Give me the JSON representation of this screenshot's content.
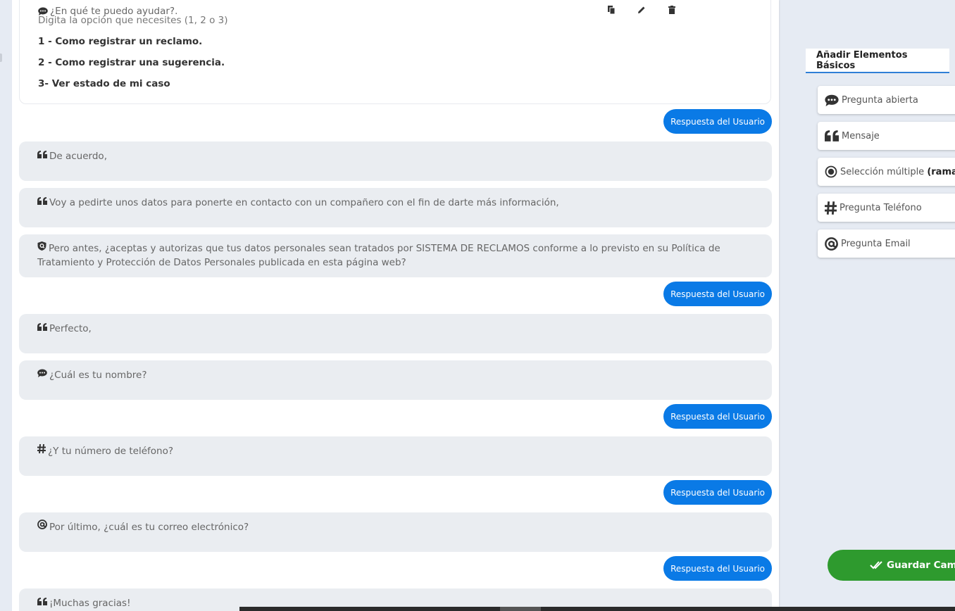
{
  "top_card": {
    "question": "¿En qué te puedo ayudar?.",
    "subtitle": "Digita la opción que necesites (1, 2 o 3)",
    "options": [
      "1 - Como registrar un reclamo.",
      "2 - Como registrar una sugerencia.",
      "3-  Ver estado de mi caso"
    ],
    "actions": [
      "copy-icon",
      "pencil-icon",
      "trash-icon"
    ]
  },
  "reply_label": "Respuesta del Usuario",
  "messages": [
    {
      "icon": "quote-icon",
      "text": "De acuerdo,"
    },
    {
      "icon": "quote-icon",
      "text": "Voy a pedirte unos datos para ponerte en contacto con un compañero con el fin de darte más información,"
    },
    {
      "icon": "shield-icon",
      "text": "Pero antes, ¿aceptas y autorizas que tus datos personales sean tratados por SISTEMA DE RECLAMOS conforme a lo previsto en su Política de Tratamiento y Protección de Datos Personales publicada en esta página web?"
    },
    {
      "icon": "quote-icon",
      "text": "Perfecto,"
    },
    {
      "icon": "comment-icon",
      "text": "¿Cuál es tu nombre?"
    },
    {
      "icon": "hash-icon",
      "text": "¿Y tu número de teléfono?"
    },
    {
      "icon": "at-icon",
      "text": "Por último, ¿cuál es tu correo electrónico?"
    },
    {
      "icon": "quote-icon",
      "text": "¡Muchas gracias!"
    }
  ],
  "sidebar": {
    "tab_title": "Añadir Elementos Básicos",
    "elements": [
      {
        "icon": "comment-icon",
        "label": "Pregunta abierta",
        "bold": ""
      },
      {
        "icon": "quote-icon",
        "label": "Mensaje",
        "bold": ""
      },
      {
        "icon": "radio-icon",
        "label": "Selección múltiple ",
        "bold": "(rama"
      },
      {
        "icon": "hash-icon",
        "label": "Pregunta Teléfono",
        "bold": ""
      },
      {
        "icon": "at-icon",
        "label": "Pregunta Email",
        "bold": ""
      }
    ],
    "save_label": "Guardar Cambi"
  },
  "colors": {
    "accent_blue": "#0a7ae6",
    "save_green": "#2e9a2e",
    "message_bg": "#eaedf1"
  }
}
